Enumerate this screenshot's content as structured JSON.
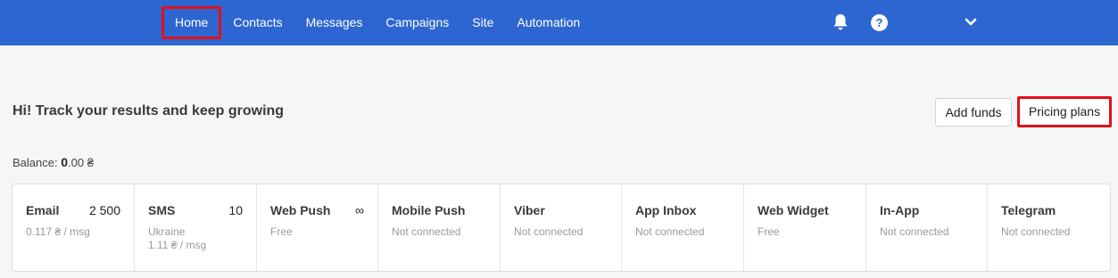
{
  "nav": {
    "items": [
      "Home",
      "Contacts",
      "Messages",
      "Campaigns",
      "Site",
      "Automation"
    ],
    "active": "Home"
  },
  "icons": {
    "bell": "bell-icon",
    "help": "help-icon",
    "chevron": "chevron-down-icon"
  },
  "header": {
    "greeting": "Hi! Track your results and keep growing",
    "add_funds": "Add funds",
    "pricing_plans": "Pricing plans"
  },
  "balance": {
    "label": "Balance:",
    "whole": "0",
    "fraction": ".00 ₴"
  },
  "channels": [
    {
      "name": "Email",
      "count": "2 500",
      "sub1": "0.117 ₴ / msg",
      "sub2": ""
    },
    {
      "name": "SMS",
      "count": "10",
      "sub1": "Ukraine",
      "sub2": "1.11 ₴ / msg"
    },
    {
      "name": "Web Push",
      "count": "∞",
      "sub1": "Free",
      "sub2": ""
    },
    {
      "name": "Mobile Push",
      "count": "",
      "sub1": "Not connected",
      "sub2": ""
    },
    {
      "name": "Viber",
      "count": "",
      "sub1": "Not connected",
      "sub2": ""
    },
    {
      "name": "App Inbox",
      "count": "",
      "sub1": "Not connected",
      "sub2": ""
    },
    {
      "name": "Web Widget",
      "count": "",
      "sub1": "Free",
      "sub2": ""
    },
    {
      "name": "In-App",
      "count": "",
      "sub1": "Not connected",
      "sub2": ""
    },
    {
      "name": "Telegram",
      "count": "",
      "sub1": "Not connected",
      "sub2": ""
    }
  ],
  "colors": {
    "topbar": "#2d66d0",
    "highlight": "#e3101a",
    "background": "#f6f6f6"
  }
}
